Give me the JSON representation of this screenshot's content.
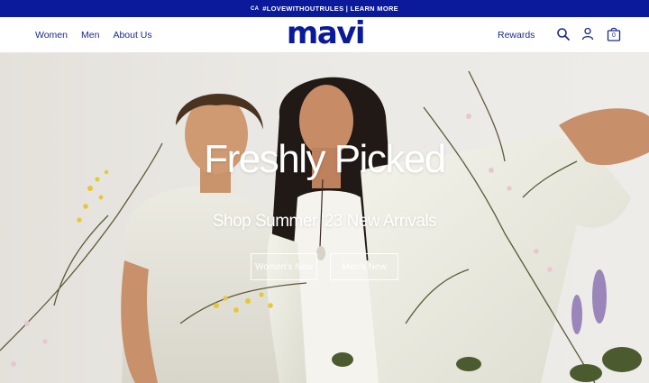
{
  "announcement": {
    "region": "CA",
    "text": "#LOVEWITHOUTRULES | LEARN MORE"
  },
  "nav": {
    "women": "Women",
    "men": "Men",
    "about": "About Us"
  },
  "logo": {
    "text": "mavi"
  },
  "header_right": {
    "rewards": "Rewards",
    "cart_count": "0"
  },
  "hero": {
    "title": "Freshly Picked",
    "subtitle": "Shop Summer '23 New Arrivals",
    "cta_women": "Women's New",
    "cta_men": "Men's New"
  },
  "icons": [
    "search-icon",
    "account-icon",
    "cart-icon"
  ],
  "colors": {
    "brand": "#0b1a9b",
    "nav_text": "#1b2a8c",
    "hero_text": "#ffffff"
  }
}
